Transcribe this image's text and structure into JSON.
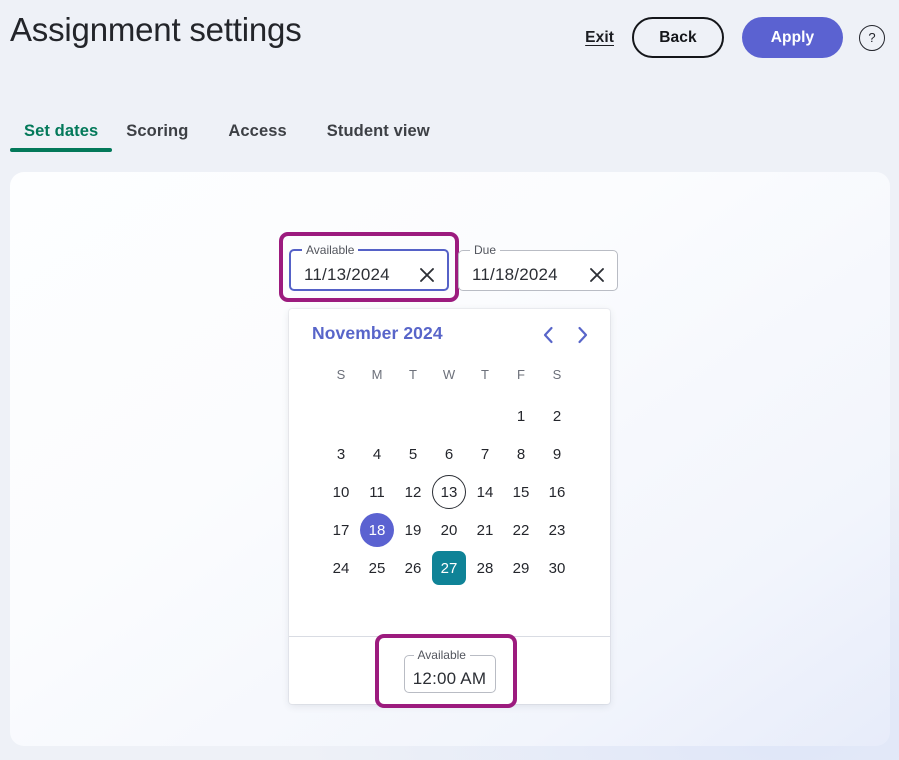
{
  "header": {
    "title": "Assignment settings",
    "exit_label": "Exit",
    "back_label": "Back",
    "apply_label": "Apply",
    "help_glyph": "?",
    "accent_apply_bg": "#5b62d1"
  },
  "tabs": {
    "active_index": 0,
    "active_color": "#03795a",
    "items": [
      {
        "label": "Set dates"
      },
      {
        "label": "Scoring"
      },
      {
        "label": "Access"
      },
      {
        "label": "Student view"
      }
    ]
  },
  "date_fields": [
    {
      "legend": "Available",
      "value": "11/13/2024",
      "focused": true,
      "highlighted": true,
      "clear_icon": "close-icon"
    },
    {
      "legend": "Due",
      "value": "11/18/2024",
      "focused": false,
      "highlighted": false,
      "clear_icon": "close-icon"
    }
  ],
  "calendar": {
    "month_label": "November 2024",
    "month_color": "#5865c9",
    "prev_icon": "chevron-left-icon",
    "next_icon": "chevron-right-icon",
    "weekdays": [
      "S",
      "M",
      "T",
      "W",
      "T",
      "F",
      "S"
    ],
    "leading_blanks": 5,
    "days": [
      1,
      2,
      3,
      4,
      5,
      6,
      7,
      8,
      9,
      10,
      11,
      12,
      13,
      14,
      15,
      16,
      17,
      18,
      19,
      20,
      21,
      22,
      23,
      24,
      25,
      26,
      27,
      28,
      29,
      30
    ],
    "today": 13,
    "selected": 18,
    "range_end": 27,
    "selected_color": "#5b62d1",
    "range_end_color": "#0f8397",
    "time": {
      "legend": "Available",
      "value": "12:00 AM",
      "highlighted": true
    }
  },
  "highlight_color": "#9c1b7e"
}
